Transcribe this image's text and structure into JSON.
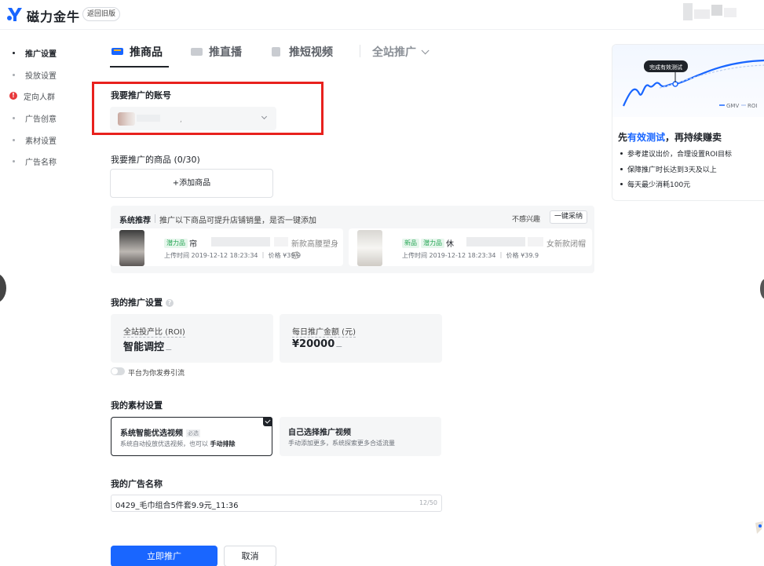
{
  "header": {
    "brand": "磁力金牛",
    "back_to_old": "返回旧版"
  },
  "sidebar": {
    "items": [
      {
        "label": "推广设置",
        "active": true
      },
      {
        "label": "投放设置",
        "active": false
      },
      {
        "label": "定向人群",
        "active": false,
        "error": true
      },
      {
        "label": "广告创意",
        "active": false
      },
      {
        "label": "素材设置",
        "active": false
      },
      {
        "label": "广告名称",
        "active": false
      }
    ]
  },
  "tabs": [
    {
      "label": "推商品",
      "active": true,
      "icon": "shopping-cart-icon"
    },
    {
      "label": "推直播",
      "active": false,
      "icon": "live-icon"
    },
    {
      "label": "推短视频",
      "active": false,
      "icon": "video-icon"
    }
  ],
  "site_promo": {
    "label": "全站推广"
  },
  "account": {
    "title": "我要推广的账号",
    "separator": ","
  },
  "products": {
    "title": "我要推广的商品 (0/30)",
    "add_label": "+添加商品"
  },
  "recommend": {
    "title": "系统推荐",
    "desc": "推广以下商品可提升店铺销量，是否一键添加",
    "not_interested": "不感兴趣",
    "one_click": "一键采纳",
    "items": [
      {
        "tags": [
          "潜力品"
        ],
        "name_prefix": "帘",
        "name_suffix": "新款高腰塑身感",
        "meta": "上传时间 2019-12-12 18:23:34 ｜ 价格 ¥39.9"
      },
      {
        "tags": [
          "新品",
          "潜力品"
        ],
        "name_prefix": "休",
        "name_suffix": "女新款闭帽",
        "meta": "上传时间 2019-12-12 18:23:34 ｜ 价格 ¥39.9"
      }
    ]
  },
  "promo_settings": {
    "title": "我的推广设置",
    "roi_label": "全站投产比 (ROI)",
    "roi_value": "智能调控",
    "budget_label": "每日推广金额 (元)",
    "budget_value": "¥20000",
    "toggle_label": "平台为你发券引流"
  },
  "material": {
    "title": "我的素材设置",
    "option1_title": "系统智能优选视频",
    "option1_badge": "必选",
    "option1_sub": "系统自动投放优选视频，也可以",
    "option1_sub_bold": "手动排除",
    "option2_title": "自己选择推广视频",
    "option2_sub": "手动添加更多，系统探索更多合适流量"
  },
  "ad_name": {
    "title": "我的广告名称",
    "value": "0429_毛巾组合5件套9.9元_11:36",
    "count": "12/50"
  },
  "actions": {
    "submit": "立即推广",
    "cancel": "取消"
  },
  "right_panel": {
    "bubble": "完成有效测试",
    "legend_gmv": "GMV",
    "legend_roi": "ROI",
    "heading_pre": "先",
    "heading_hl": "有效测试",
    "heading_post": "，再持续赚卖",
    "bullets": [
      "参考建议出价，合理设置ROI目标",
      "保障推广时长达到3天及以上",
      "每天最少消耗100元"
    ]
  },
  "colors": {
    "primary": "#1966ff",
    "highlight_box": "#e8211d",
    "tag_green": "#2aa858"
  }
}
